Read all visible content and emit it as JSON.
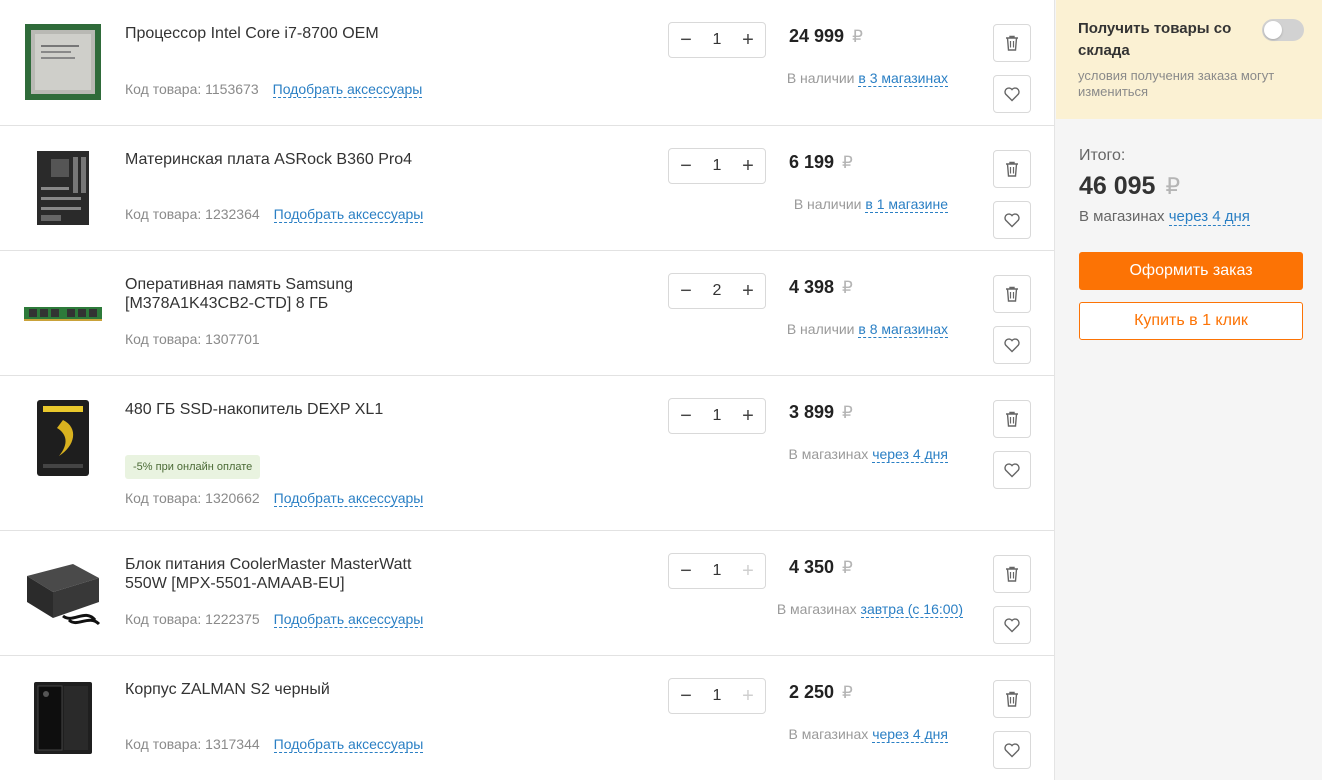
{
  "cart": {
    "items": [
      {
        "title": "Процессор Intel Core i7-8700 OEM",
        "code_label": "Код товара: 1153673",
        "accessories": "Подобрать аксессуары",
        "quantity": "1",
        "minus": "−",
        "plus": "+",
        "plus_disabled": false,
        "price": "24 999",
        "currency": "₽",
        "avail_prefix": "В наличии",
        "avail_link": "в 3 магазинах",
        "badge": "",
        "image_icon": "cpu-image"
      },
      {
        "title": "Материнская плата ASRock B360 Pro4",
        "code_label": "Код товара: 1232364",
        "accessories": "Подобрать аксессуары",
        "quantity": "1",
        "minus": "−",
        "plus": "+",
        "plus_disabled": false,
        "price": "6 199",
        "currency": "₽",
        "avail_prefix": "В наличии",
        "avail_link": "в 1 магазине",
        "badge": "",
        "image_icon": "motherboard-image"
      },
      {
        "title": "Оперативная память Samsung [M378A1K43CB2-CTD] 8 ГБ",
        "code_label": "Код товара: 1307701",
        "accessories": "",
        "quantity": "2",
        "minus": "−",
        "plus": "+",
        "plus_disabled": false,
        "price": "4 398",
        "currency": "₽",
        "avail_prefix": "В наличии",
        "avail_link": "в 8 магазинах",
        "badge": "",
        "image_icon": "ram-image"
      },
      {
        "title": "480 ГБ SSD-накопитель DEXP XL1",
        "code_label": "Код товара: 1320662",
        "accessories": "Подобрать аксессуары",
        "quantity": "1",
        "minus": "−",
        "plus": "+",
        "plus_disabled": false,
        "price": "3 899",
        "currency": "₽",
        "avail_prefix": "В магазинах",
        "avail_link": "через 4 дня",
        "badge": "-5% при онлайн оплате",
        "image_icon": "ssd-image"
      },
      {
        "title": "Блок питания CoolerMaster MasterWatt 550W [MPX-5501-AMAAB-EU]",
        "code_label": "Код товара: 1222375",
        "accessories": "Подобрать аксессуары",
        "quantity": "1",
        "minus": "−",
        "plus": "+",
        "plus_disabled": true,
        "price": "4 350",
        "currency": "₽",
        "avail_prefix": "В магазинах",
        "avail_link": "завтра (с 16:00)",
        "badge": "",
        "image_icon": "psu-image"
      },
      {
        "title": "Корпус ZALMAN S2 черный",
        "code_label": "Код товара: 1317344",
        "accessories": "Подобрать аксессуары",
        "quantity": "1",
        "minus": "−",
        "plus": "+",
        "plus_disabled": true,
        "price": "2 250",
        "currency": "₽",
        "avail_prefix": "В магазинах",
        "avail_link": "через 4 дня",
        "badge": "",
        "image_icon": "case-image"
      }
    ]
  },
  "sidebar": {
    "pickup_title": "Получить товары со склада",
    "pickup_note": "условия получения заказа могут измениться",
    "toggle_on": false,
    "total_label": "Итого:",
    "total_value": "46 095",
    "currency": "₽",
    "delivery_prefix": "В магазинах",
    "delivery_link": "через 4 дня",
    "order_button": "Оформить заказ",
    "oneclick_button": "Купить в 1 клик"
  },
  "colors": {
    "accent": "#fc7305",
    "link": "#2a7fc4",
    "pickup_bg": "#fbf1d3",
    "badge_bg": "#e9f3e0"
  }
}
